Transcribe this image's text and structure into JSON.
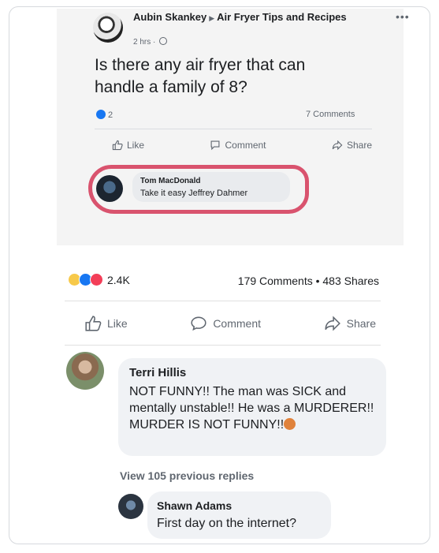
{
  "top_post": {
    "author": "Aubin Skankey",
    "group": "Air Fryer Tips and Recipes",
    "time": "2 hrs",
    "text": "Is there any air fryer that can handle a family of 8?",
    "reaction_count": "2",
    "comments": "7 Comments",
    "actions": {
      "like": "Like",
      "comment": "Comment",
      "share": "Share"
    },
    "comment": {
      "name": "Tom MacDonald",
      "text": "Take it easy Jeffrey Dahmer"
    }
  },
  "bottom_post": {
    "reaction_count": "2.4K",
    "counts": "179 Comments • 483 Shares",
    "actions": {
      "like": "Like",
      "comment": "Comment",
      "share": "Share"
    },
    "comments": [
      {
        "name": "Terri Hillis",
        "text": "NOT FUNNY!! The man was SICK and mentally unstable!! He was a MURDERER!! MURDER IS NOT FUNNY!!"
      },
      {
        "name": "Shawn Adams",
        "text": "First day on the internet?"
      }
    ],
    "view_replies": "View 105 previous replies"
  },
  "colors": {
    "highlight": "#d9536e",
    "like_blue": "#1877f2"
  },
  "icons": [
    "like-icon",
    "comment-icon",
    "share-icon",
    "globe-icon",
    "more-icon",
    "angry-emoji-icon"
  ]
}
